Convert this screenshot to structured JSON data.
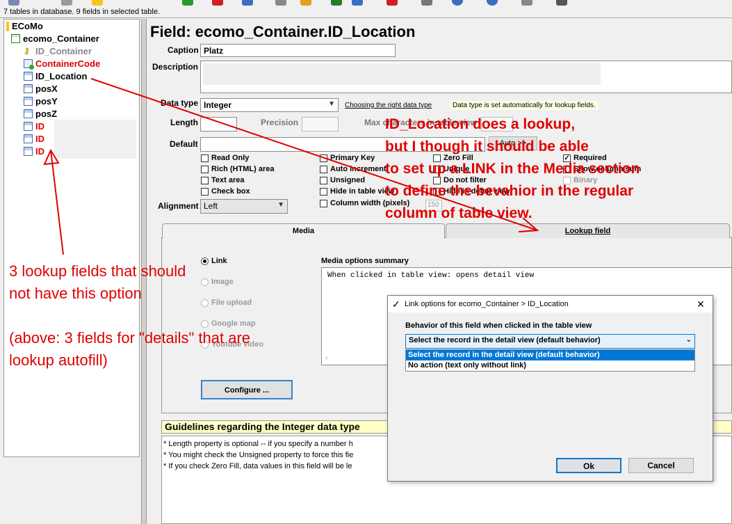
{
  "status_text": "7 tables in database. 9 fields in selected table.",
  "tree": {
    "root": "ECoMo",
    "table": "ecomo_Container",
    "fields": [
      {
        "label": "ID_Container",
        "style": "grey",
        "icon": "key-icon"
      },
      {
        "label": "ContainerCode",
        "style": "red",
        "icon": "field-code-icon"
      },
      {
        "label": "ID_Location",
        "style": "black",
        "icon": "field-icon"
      },
      {
        "label": "posX",
        "style": "black",
        "icon": "field-icon"
      },
      {
        "label": "posY",
        "style": "black",
        "icon": "field-icon"
      },
      {
        "label": "posZ",
        "style": "black",
        "icon": "field-icon"
      },
      {
        "label": "ID",
        "style": "red",
        "icon": "field-icon"
      },
      {
        "label": "ID",
        "style": "red",
        "icon": "field-icon"
      },
      {
        "label": "ID",
        "style": "red",
        "icon": "field-icon"
      }
    ]
  },
  "field_title": "Field: ecomo_Container.ID_Location",
  "form": {
    "caption_label": "Caption",
    "caption_value": "Platz",
    "description_label": "Description",
    "description_value": "",
    "datatype_label": "Data type",
    "datatype_value": "Integer",
    "datatype_link": "Choosing the right data type",
    "datatype_note": "Data type is set automatically for lookup fields.",
    "length_label": "Length",
    "precision_label": "Precision",
    "maxchars_label": "Max characters in table view",
    "default_label": "Default",
    "auto_button": "Auto >>",
    "alignment_label": "Alignment",
    "alignment_value": "Left",
    "column_width_value": "150"
  },
  "checkboxes": {
    "read_only": {
      "label": "Read Only",
      "checked": false
    },
    "rich_html": {
      "label": "Rich (HTML) area",
      "checked": false
    },
    "text_area": {
      "label": "Text area",
      "checked": false
    },
    "check_box": {
      "label": "Check box",
      "checked": false
    },
    "primary_key": {
      "label": "Primary Key",
      "checked": false
    },
    "auto_increment": {
      "label": "Auto increment",
      "checked": false
    },
    "unsigned": {
      "label": "Unsigned",
      "checked": false
    },
    "hide_table_view": {
      "label": "Hide in table view",
      "checked": false
    },
    "column_width": {
      "label": "Column width (pixels)",
      "checked": false
    },
    "zero_fill": {
      "label": "Zero Fill",
      "checked": false
    },
    "unique": {
      "label": "Unique",
      "checked": false
    },
    "do_not_filter": {
      "label": "Do not filter",
      "checked": false
    },
    "hide_detail_view": {
      "label": "Hide in detail view",
      "checked": false
    },
    "required": {
      "label": "Required",
      "checked": true
    },
    "show_column_sum": {
      "label": "Show column sum",
      "checked": false
    },
    "binary": {
      "label": "Binary",
      "checked": false
    }
  },
  "tabs": {
    "media": "Media",
    "lookup": "Lookup field"
  },
  "media": {
    "options": [
      {
        "label": "Link",
        "selected": true
      },
      {
        "label": "Image",
        "selected": false
      },
      {
        "label": "File upload",
        "selected": false
      },
      {
        "label": "Google map",
        "selected": false
      },
      {
        "label": "Youtube video",
        "selected": false
      }
    ],
    "summary_label": "Media options summary",
    "summary_text": "When clicked in table view: opens detail view",
    "configure_button": "Configure ..."
  },
  "guidelines": {
    "title": "Guidelines regarding the Integer data type",
    "lines": [
      "* Length property is optional -- if you specify a number h",
      "* You might check the Unsigned property to force this fie",
      "* If you check Zero Fill, data values in this field will be le"
    ]
  },
  "dialog": {
    "title": "Link options for ecomo_Container > ID_Location",
    "behavior_label": "Behavior of this field when clicked in the table view",
    "selected_value": "Select the record in the detail view (default behavior)",
    "options": [
      "Select the record in the detail view (default behavior)",
      "No action (text only without link)"
    ],
    "ok_button": "Ok",
    "cancel_button": "Cancel",
    "close_symbol": "✕",
    "check_symbol": "✓"
  },
  "annotations": {
    "right_lines": [
      "ID_Location does a lookup,",
      "but I though it should be able",
      "to set up a LINK in the Media section",
      "to define the bevahior in the regular",
      "column of table view."
    ],
    "left_lines": [
      "3 lookup fields that should",
      "not have this option",
      "",
      "(above: 3 fields for \"details\" that are",
      "lookup autofill)"
    ],
    "color": "#e00000"
  }
}
